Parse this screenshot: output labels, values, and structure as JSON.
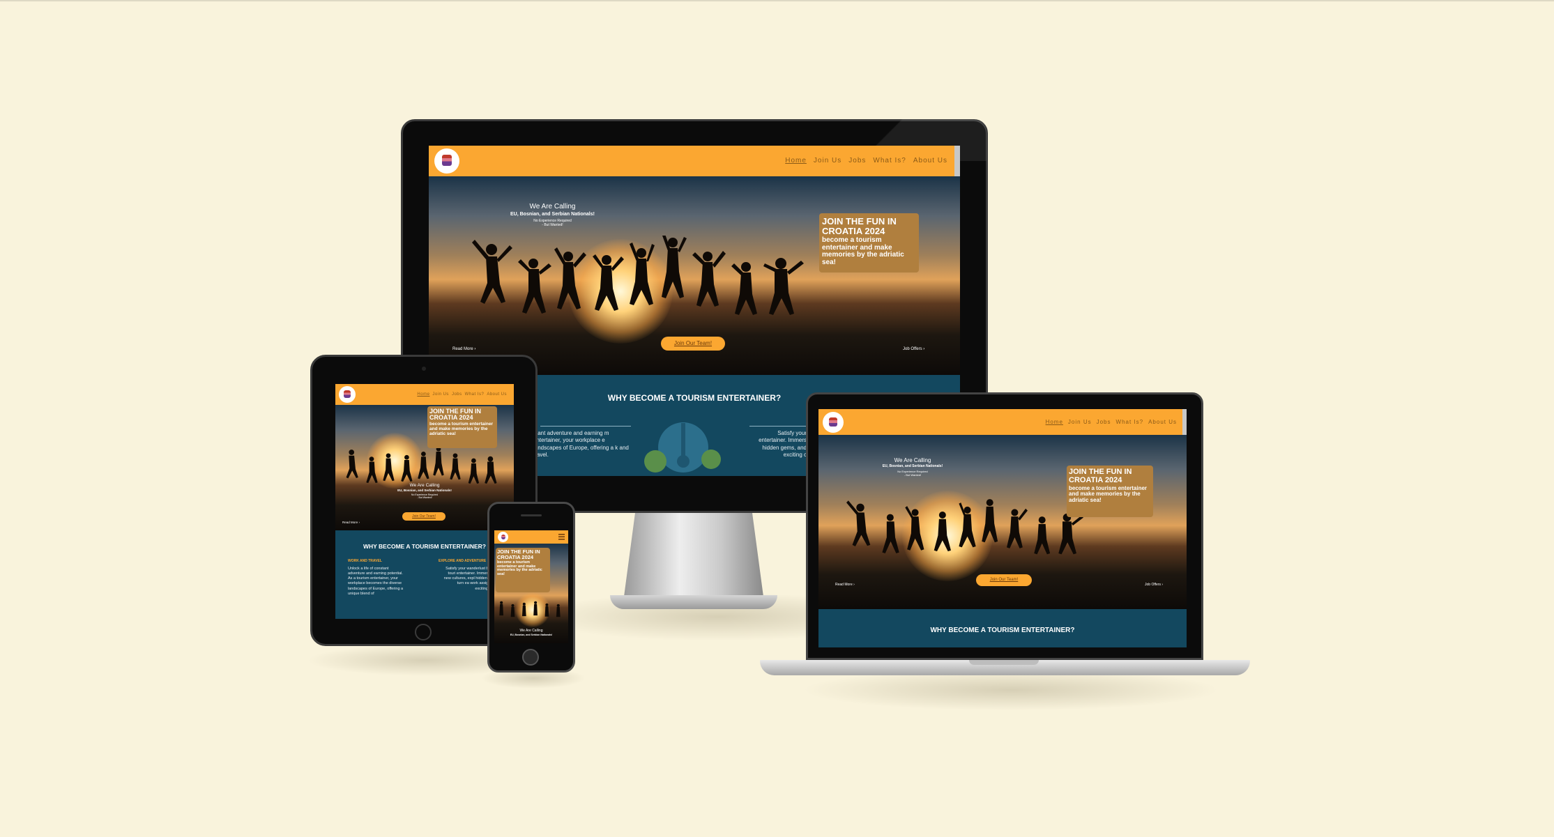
{
  "site": {
    "nav_items": [
      "Home",
      "Join Us",
      "Jobs",
      "What Is?",
      "About Us"
    ],
    "hero": {
      "calling_line1": "We Are Calling",
      "calling_line2": "EU, Bosnian, and Serbian Nationals!",
      "calling_line3": "No Experience Required",
      "calling_line4": "- But Wanted!",
      "headline": "JOIN THE FUN IN CROATIA 2024",
      "subline": "become a tourism entertainer and make memories by the adriatic sea!",
      "cta": "Join Our Team!",
      "read_more": "Read More",
      "job_offers": "Job Offers"
    },
    "section_title": "WHY BECOME A TOURISM ENTERTAINER?",
    "col_left": "stant adventure and earning m entertainer, your workplace e landscapes of Europe, offering a k and travel.",
    "col_right": "Satisfy your entertainer. Immers hidden gems, and exciting c",
    "tablet": {
      "col_left_title": "WORK AND TRAVEL",
      "col_right_title": "EXPLORE AND ADVENTURE",
      "col_left": "Unlock a life of constant adventure and earning potential. As a tourism entertainer, your workplace becomes the diverse landscapes of Europe, offering a unique blend of",
      "col_right": "Satisfy your wanderlust becoming a touri entertainer. Immerse yours in new cultures, expl hidden gems, and turn ea work assignment into exciting chapter of"
    }
  },
  "colors": {
    "background": "#f9f3dc",
    "nav_orange": "#fba731",
    "section_teal": "#13485f",
    "callout_tan": "#b07f3e"
  }
}
